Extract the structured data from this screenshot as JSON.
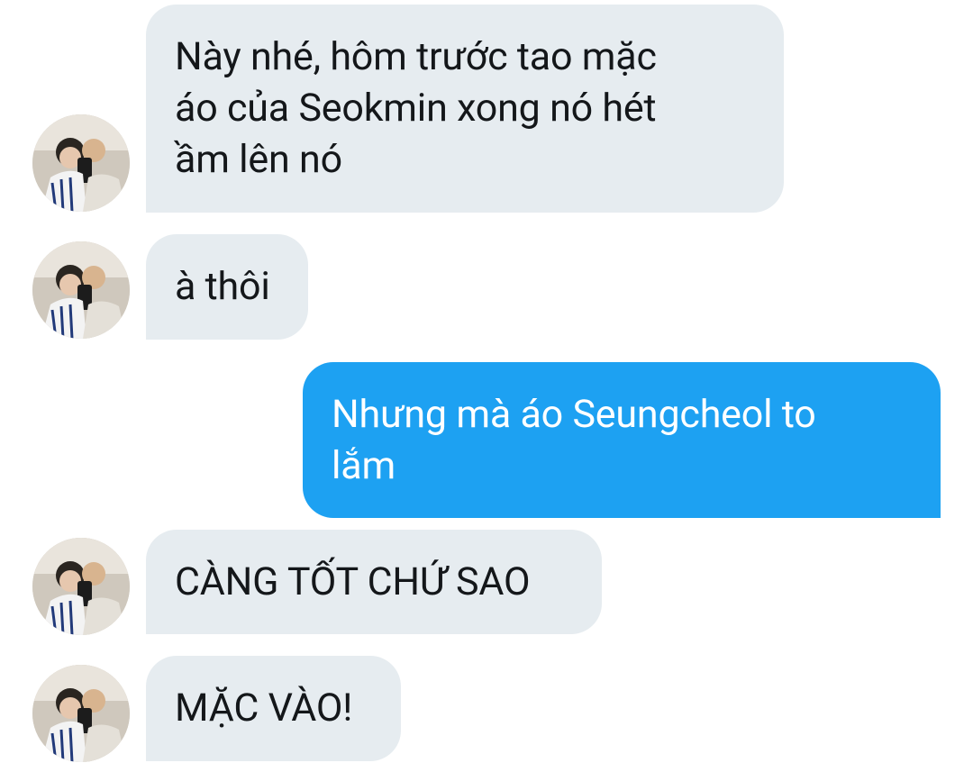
{
  "conversation": {
    "messages": [
      {
        "sender": "other",
        "text": "Này nhé, hôm trước tao mặc\náo của Seokmin xong nó hét\nầm lên nó"
      },
      {
        "sender": "other",
        "text": "à thôi"
      },
      {
        "sender": "me",
        "text": "Nhưng mà áo Seungcheol to\nlắm"
      },
      {
        "sender": "other",
        "text": "CÀNG TỐT CHỨ SAO"
      },
      {
        "sender": "other",
        "text": "MẶC VÀO!"
      }
    ]
  },
  "colors": {
    "incoming_bubble": "#e6ecf0",
    "outgoing_bubble": "#1da1f2",
    "incoming_text": "#14171a",
    "outgoing_text": "#ffffff"
  },
  "icons": {
    "avatar": "profile-photo"
  }
}
